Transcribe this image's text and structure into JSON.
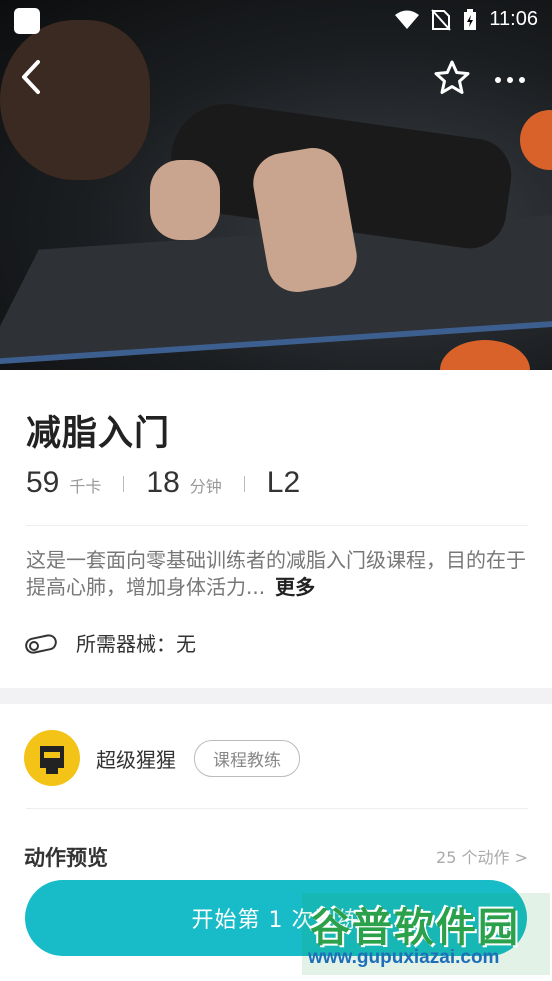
{
  "status_bar": {
    "time": "11:06"
  },
  "course": {
    "title": "减脂入门",
    "stats": [
      {
        "value": "59",
        "unit": "千卡"
      },
      {
        "value": "18",
        "unit": "分钟"
      },
      {
        "value": "L2",
        "unit": ""
      }
    ],
    "description": "这是一套面向零基础训练者的减脂入门级课程，目的在于提高心肺，增加身体活力...",
    "more_label": "更多",
    "equipment": "所需器械：无"
  },
  "coach": {
    "name": "超级猩猩",
    "tag": "课程教练"
  },
  "preview": {
    "title": "动作预览",
    "count": "25 个动作 >"
  },
  "start_button": "开始第 1 次训练",
  "watermark": {
    "title": "谷普软件园",
    "url": "www.gupuxiazai.com"
  },
  "colors": {
    "accent": "#18bcc8",
    "coach_avatar": "#f3c318"
  }
}
